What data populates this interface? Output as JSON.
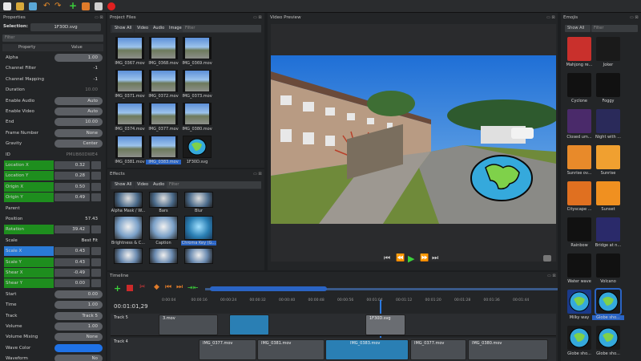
{
  "toolbar": {
    "icons": [
      "new-file-icon",
      "open-icon",
      "save-icon",
      "undo-icon",
      "redo-icon",
      "add-icon",
      "film-icon",
      "fullscreen-icon",
      "record-icon"
    ]
  },
  "properties": {
    "title": "Properties",
    "selection_label": "Selection:",
    "selection_value": "1F30D.svg",
    "filter_placeholder": "Filter",
    "col_property": "Property",
    "col_value": "Value",
    "rows": [
      {
        "label": "Alpha",
        "value": "1.00",
        "kind": "pill"
      },
      {
        "label": "Channel Filter",
        "value": "-1",
        "kind": "text"
      },
      {
        "label": "Channel Mapping",
        "value": "-1",
        "kind": "text"
      },
      {
        "label": "Duration",
        "value": "10.00",
        "kind": "dim"
      },
      {
        "label": "Enable Audio",
        "value": "Auto",
        "kind": "pill"
      },
      {
        "label": "Enable Video",
        "value": "Auto",
        "kind": "pill"
      },
      {
        "label": "End",
        "value": "10.00",
        "kind": "pill"
      },
      {
        "label": "Frame Number",
        "value": "None",
        "kind": "pill"
      },
      {
        "label": "Gravity",
        "value": "Center",
        "kind": "pill"
      },
      {
        "label": "ID",
        "value": "PMUB60DWE4",
        "kind": "dim"
      },
      {
        "label": "Location X",
        "value": "0.32",
        "kind": "green"
      },
      {
        "label": "Location Y",
        "value": "0.28",
        "kind": "green"
      },
      {
        "label": "Origin X",
        "value": "0.50",
        "kind": "green"
      },
      {
        "label": "Origin Y",
        "value": "0.49",
        "kind": "green"
      },
      {
        "label": "Parent",
        "value": "",
        "kind": "text"
      },
      {
        "label": "Position",
        "value": "57.43",
        "kind": "text"
      },
      {
        "label": "Rotation",
        "value": "39.42",
        "kind": "green"
      },
      {
        "label": "Scale",
        "value": "Best Fit",
        "kind": "text"
      },
      {
        "label": "Scale X",
        "value": "0.43",
        "kind": "blue"
      },
      {
        "label": "Scale Y",
        "value": "0.43",
        "kind": "green"
      },
      {
        "label": "Shear X",
        "value": "-0.49",
        "kind": "green"
      },
      {
        "label": "Shear Y",
        "value": "0.00",
        "kind": "green"
      },
      {
        "label": "Start",
        "value": "0.00",
        "kind": "pill"
      },
      {
        "label": "Time",
        "value": "1.00",
        "kind": "pill"
      },
      {
        "label": "Track",
        "value": "Track 5",
        "kind": "pill"
      },
      {
        "label": "Volume",
        "value": "1.00",
        "kind": "pill"
      },
      {
        "label": "Volume Mixing",
        "value": "None",
        "kind": "pill"
      },
      {
        "label": "Wave Color",
        "value": "",
        "kind": "bluebar"
      },
      {
        "label": "Waveform",
        "value": "No",
        "kind": "pill"
      }
    ]
  },
  "project_files": {
    "title": "Project Files",
    "tabs": [
      "Show All",
      "Video",
      "Audio",
      "Image"
    ],
    "filter_placeholder": "Filter",
    "items": [
      "IMG_0367.mov",
      "IMG_0368.mov",
      "IMG_0369.mov",
      "IMG_0371.mov",
      "IMG_0372.mov",
      "IMG_0373.mov",
      "IMG_0374.mov",
      "IMG_0377.mov",
      "IMG_0380.mov",
      "IMG_0381.mov",
      "IMG_0383.mov",
      "1F30D.svg"
    ]
  },
  "effects": {
    "title": "Effects",
    "tabs": [
      "Show All",
      "Video",
      "Audio"
    ],
    "filter_placeholder": "Filter",
    "items": [
      "Alpha Mask / W...",
      "Bars",
      "Blur",
      "Brightness & C...",
      "Caption",
      "Chroma Key (G..."
    ]
  },
  "preview": {
    "title": "Video Preview"
  },
  "emojis": {
    "title": "Emojis",
    "dropdown": "Show All",
    "filter_placeholder": "Filter",
    "items": [
      "Mahjong re...",
      "Joker",
      "Cyclone",
      "Foggy",
      "Closed um...",
      "Night with ...",
      "Sunrise ov...",
      "Sunrise",
      "Cityscape ...",
      "Sunset",
      "Rainbow",
      "Bridge at n...",
      "Water wave",
      "Volcano",
      "Milky way",
      "Globe sho...",
      "Globe sho...",
      "Globe sho..."
    ]
  },
  "timeline": {
    "title": "Timeline",
    "time": "00:01:01,29",
    "ticks": [
      "0:00:04",
      "00:00:16",
      "00:00:24",
      "00:00:32",
      "00:00:40",
      "00:00:48",
      "00:00:56",
      "00:01:04",
      "00:01:12",
      "00:01:20",
      "00:01:28",
      "00:01:36",
      "00:01:44"
    ],
    "tracks": [
      "Track 5",
      "Track 4"
    ],
    "clips_track5": [
      "3.mov",
      "1F30D.svg"
    ],
    "clips_track4": [
      "IMG_0377.mov",
      "IMG_0381.mov",
      "IMG_0383.mov",
      "IMG_0377.mov",
      "IMG_0380.mov"
    ]
  }
}
